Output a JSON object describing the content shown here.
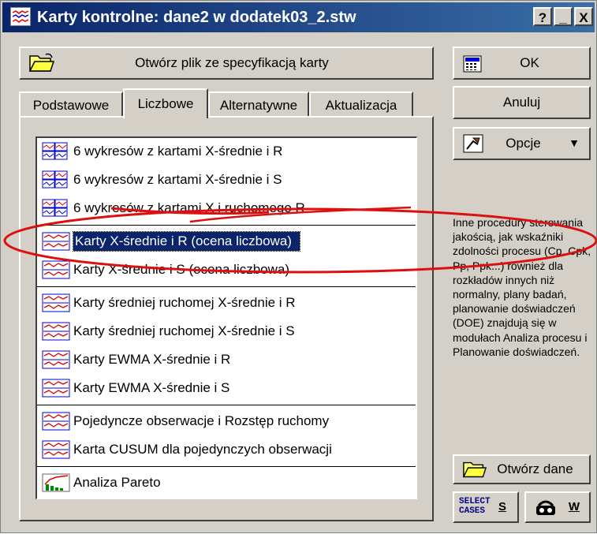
{
  "window": {
    "title": "Karty kontrolne: dane2 w dodatek03_2.stw",
    "buttons": [
      "?",
      "_",
      "X"
    ]
  },
  "open_spec_button": "Otwórz plik ze specyfikacją karty",
  "tabs": [
    {
      "label": "Podstawowe",
      "active": false
    },
    {
      "label": "Liczbowe",
      "active": true
    },
    {
      "label": "Alternatywne",
      "active": false
    },
    {
      "label": "Aktualizacja",
      "active": false
    }
  ],
  "list": {
    "groups": [
      {
        "items": [
          {
            "label": "6 wykresów z kartami X-średnie i R",
            "icon": "multi-chart-icon"
          },
          {
            "label": "6 wykresów z kartami X-średnie i S",
            "icon": "multi-chart-icon"
          },
          {
            "label": "6 wykresów z kartami X i ruchomego R",
            "icon": "multi-chart-icon"
          }
        ]
      },
      {
        "items": [
          {
            "label": "Karty X-średnie i R (ocena liczbowa)",
            "icon": "control-chart-icon",
            "selected": true
          },
          {
            "label": "Karty X-średnie i S (ocena liczbowa)",
            "icon": "control-chart-icon"
          }
        ]
      },
      {
        "items": [
          {
            "label": "Karty średniej ruchomej X-średnie i R",
            "icon": "control-chart-icon"
          },
          {
            "label": "Karty średniej ruchomej X-średnie i S",
            "icon": "control-chart-icon"
          },
          {
            "label": "Karty EWMA X-średnie i R",
            "icon": "control-chart-icon"
          },
          {
            "label": "Karty EWMA X-średnie i S",
            "icon": "control-chart-icon"
          }
        ]
      },
      {
        "items": [
          {
            "label": "Pojedyncze obserwacje i Rozstęp ruchomy",
            "icon": "control-chart-icon"
          },
          {
            "label": "Karta CUSUM dla pojedynczych obserwacji",
            "icon": "control-chart-icon"
          }
        ]
      },
      {
        "items": [
          {
            "label": "Analiza Pareto",
            "icon": "pareto-chart-icon"
          }
        ]
      }
    ]
  },
  "side": {
    "ok": "OK",
    "cancel": "Anuluj",
    "options": "Opcje",
    "info": "Inne procedury sterowania jakością, jak wskaźniki zdolności procesu (Cp, Cpk, Pp, Ppk...) również dla rozkładów innych niż normalny, plany badań, planowanie doświadczeń (DOE) znajdują się w modułach Analiza procesu i Planowanie doświadczeń.",
    "open_data": "Otwórz dane",
    "select_cases_line1": "SELECT",
    "select_cases_line2": "CASES",
    "select_cases_key": "S",
    "weights_key": "W"
  },
  "colors": {
    "face": "#d4d0c8",
    "title": "#0a246a",
    "selection": "#0a246a",
    "annotation": "#dd1010"
  }
}
